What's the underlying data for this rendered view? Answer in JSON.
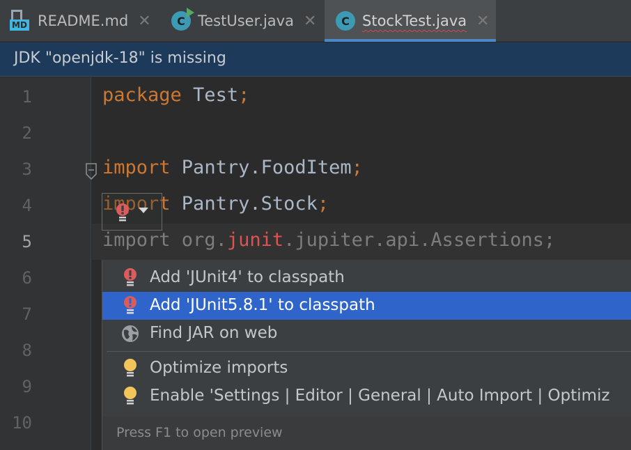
{
  "tabs": [
    {
      "label": "README.md",
      "icon": "markdown-file-icon",
      "badge": "MD"
    },
    {
      "label": "TestUser.java",
      "icon": "java-class-icon",
      "badge": "C"
    },
    {
      "label": "StockTest.java",
      "icon": "java-class-icon",
      "badge": "C",
      "active": true
    }
  ],
  "tab_close_glyph": "✕",
  "banner": {
    "text": "JDK \"openjdk-18\" is missing"
  },
  "gutter": {
    "line_numbers": [
      "1",
      "2",
      "3",
      "4",
      "5",
      "6",
      "7",
      "8",
      "9",
      "10"
    ],
    "current_line": "5"
  },
  "code": {
    "line1": {
      "keyword": "package",
      "rest": " Test",
      "semi": ";"
    },
    "line3": {
      "keyword": "import",
      "rest": " Pantry.FoodItem",
      "semi": ";"
    },
    "line4": {
      "keyword": "import",
      "rest": " Pantry.Stock",
      "semi": ";"
    },
    "line5": {
      "keyword": "import",
      "pre": " org.",
      "error": "junit",
      "post": ".jupiter.api.Assertions",
      "semi": ";"
    }
  },
  "popup": {
    "items": [
      {
        "label": "Add 'JUnit4' to classpath",
        "icon": "red-bulb-icon"
      },
      {
        "label": "Add 'JUnit5.8.1' to classpath",
        "icon": "red-bulb-icon",
        "selected": true
      },
      {
        "label": "Find JAR on web",
        "icon": "globe-icon"
      },
      {
        "label": "Optimize imports",
        "icon": "yellow-bulb-icon"
      },
      {
        "label": "Enable 'Settings | Editor | General | Auto Import | Optimiz",
        "icon": "yellow-bulb-icon"
      }
    ],
    "footer": "Press F1 to open preview"
  },
  "colors": {
    "editor_bg": "#2b2b2b",
    "keyword": "#cc7832",
    "identifier": "#a9b7c6",
    "error": "#e05252",
    "selection": "#2f65ca",
    "banner_bg": "#1d3a5a",
    "tab_underline": "#4a88c7"
  }
}
